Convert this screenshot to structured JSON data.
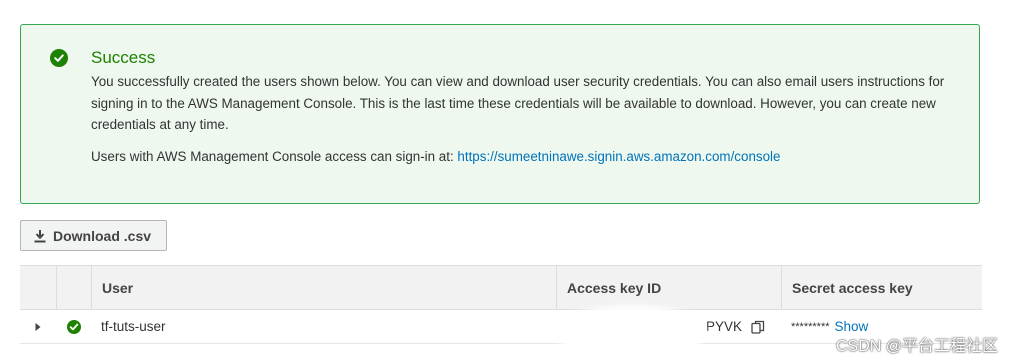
{
  "alert": {
    "title": "Success",
    "message": "You successfully created the users shown below. You can view and download user security credentials. You can also email users instructions for signing in to the AWS Management Console. This is the last time these credentials will be available to download. However, you can create new credentials at any time.",
    "signin_prefix": "Users with AWS Management Console access can sign-in at: ",
    "signin_url": "https://sumeetninawe.signin.aws.amazon.com/console",
    "icon": "check-circle-icon",
    "color": "#1d8102"
  },
  "toolbar": {
    "download_label": "Download .csv",
    "download_icon": "download-icon"
  },
  "table": {
    "columns": [
      "",
      "",
      "User",
      "Access key ID",
      "Secret access key"
    ],
    "rows": [
      {
        "user": "tf-tuts-user",
        "access_key_id_visible": "PYVK",
        "secret_masked": "*********",
        "show_label": "Show",
        "status_icon": "check-circle-icon"
      }
    ]
  },
  "watermark": "CSDN @平台工程社区",
  "colors": {
    "success_green": "#1d8102",
    "success_bg": "#eef8ef",
    "link_blue": "#0073bb"
  }
}
